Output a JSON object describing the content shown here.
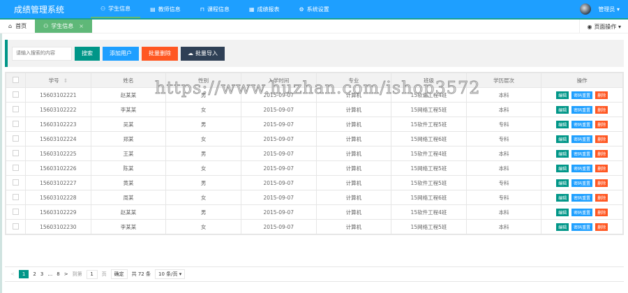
{
  "app": {
    "title": "成绩管理系统",
    "user": "管理员 ▾"
  },
  "nav": [
    {
      "label": "学生信息",
      "icon": "users-icon"
    },
    {
      "label": "教师信息",
      "icon": "book-icon"
    },
    {
      "label": "课程信息",
      "icon": "reading-icon"
    },
    {
      "label": "成绩报表",
      "icon": "table-icon"
    },
    {
      "label": "系统设置",
      "icon": "gear-icon"
    }
  ],
  "tabs": {
    "home": "首页",
    "student": "学生信息",
    "close": "×",
    "page_ops": "页面操作 ▾"
  },
  "toolbar": {
    "placeholder": "请输入搜索的内容",
    "search": "搜索",
    "add": "添加用户",
    "batch_delete": "批量删除",
    "batch_import": "批量导入"
  },
  "colors": {
    "header": "#1e9fff",
    "green": "#009688",
    "blue": "#1e9fff",
    "orange": "#ff5722",
    "dark": "#2f4056"
  },
  "table": {
    "headers": [
      "学号",
      "姓名",
      "性别",
      "入学时间",
      "专业",
      "班级",
      "学历层次",
      "操作"
    ],
    "actions": [
      "编辑",
      "密码重置",
      "删除"
    ],
    "rows": [
      [
        "15603102221",
        "赵某某",
        "男",
        "2015-09-07",
        "计算机",
        "15软件工程4班",
        "本科"
      ],
      [
        "15603102222",
        "李某某",
        "女",
        "2015-09-07",
        "计算机",
        "15网络工程5班",
        "本科"
      ],
      [
        "15603102223",
        "吴某",
        "男",
        "2015-09-07",
        "计算机",
        "15软件工程5班",
        "专科"
      ],
      [
        "15603102224",
        "郑某",
        "女",
        "2015-09-07",
        "计算机",
        "15网络工程6班",
        "专科"
      ],
      [
        "15603102225",
        "王某",
        "男",
        "2015-09-07",
        "计算机",
        "15软件工程4班",
        "本科"
      ],
      [
        "15603102226",
        "陈某",
        "女",
        "2015-09-07",
        "计算机",
        "15网络工程5班",
        "本科"
      ],
      [
        "15603102227",
        "黄某",
        "男",
        "2015-09-07",
        "计算机",
        "15软件工程5班",
        "专科"
      ],
      [
        "15603102228",
        "周某",
        "女",
        "2015-09-07",
        "计算机",
        "15网络工程6班",
        "专科"
      ],
      [
        "15603102229",
        "赵某某",
        "男",
        "2015-09-07",
        "计算机",
        "15软件工程4班",
        "本科"
      ],
      [
        "15603102230",
        "李某某",
        "女",
        "2015-09-07",
        "计算机",
        "15网络工程5班",
        "本科"
      ]
    ]
  },
  "pager": {
    "prev": "<",
    "pages": [
      "1",
      "2",
      "3",
      "…",
      "8"
    ],
    "next": ">",
    "goto": "到第",
    "page_value": "1",
    "page_unit": "页",
    "confirm": "确定",
    "total": "共 72 条",
    "per_page": "10 条/页 ▾"
  },
  "watermark": "https://www.huzhan.com/ishop3572"
}
